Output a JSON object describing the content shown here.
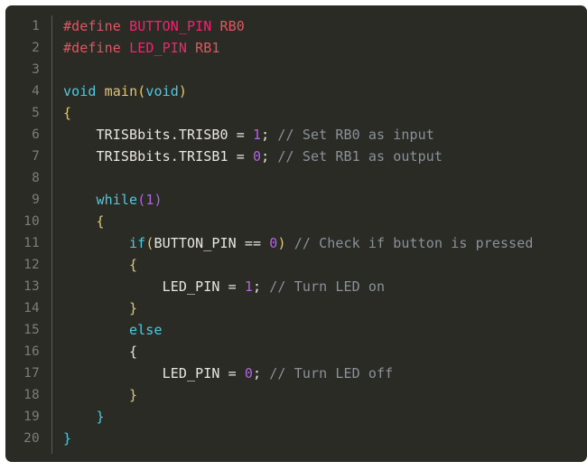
{
  "editor": {
    "title": "c-source-code-snippet",
    "language": "c",
    "background_color": "#2b2b26",
    "page_background_color": "#ffffff",
    "gutter_color": "#7d7d72",
    "gutter_rule_color": "#5a5a52",
    "default_text_color": "#e8e6df",
    "line_count": 20,
    "colors": {
      "preprocessor": "#e05561",
      "macro_name": "#f0256f",
      "macro_value": "#e05561",
      "keyword": "#4ec9e0",
      "function": "#e0c877",
      "number": "#b064dd",
      "comment": "#8a9199",
      "plain": "#e8e6df",
      "bracket_depth_1": "#e0c877",
      "bracket_depth_2": "#b064dd",
      "bracket_depth_3": "#4ec9e0"
    }
  },
  "lines": [
    {
      "number": "1",
      "text": "#define BUTTON_PIN RB0",
      "tokens": [
        {
          "t": "#define",
          "c": "tok-pre"
        },
        {
          "t": " ",
          "c": "tok-plain"
        },
        {
          "t": "BUTTON_PIN",
          "c": "tok-macro"
        },
        {
          "t": " ",
          "c": "tok-plain"
        },
        {
          "t": "RB0",
          "c": "tok-macroval"
        }
      ]
    },
    {
      "number": "2",
      "text": "#define LED_PIN RB1",
      "tokens": [
        {
          "t": "#define",
          "c": "tok-pre"
        },
        {
          "t": " ",
          "c": "tok-plain"
        },
        {
          "t": "LED_PIN",
          "c": "tok-macro"
        },
        {
          "t": " ",
          "c": "tok-plain"
        },
        {
          "t": "RB1",
          "c": "tok-macroval"
        }
      ]
    },
    {
      "number": "3",
      "text": "",
      "tokens": []
    },
    {
      "number": "4",
      "text": "void main(void)",
      "tokens": [
        {
          "t": "void",
          "c": "tok-kw"
        },
        {
          "t": " ",
          "c": "tok-plain"
        },
        {
          "t": "main",
          "c": "tok-fn"
        },
        {
          "t": "(",
          "c": "tok-b1"
        },
        {
          "t": "void",
          "c": "tok-kw"
        },
        {
          "t": ")",
          "c": "tok-b1"
        }
      ]
    },
    {
      "number": "5",
      "text": "{",
      "tokens": [
        {
          "t": "{",
          "c": "tok-b1"
        }
      ]
    },
    {
      "number": "6",
      "text": "    TRISBbits.TRISB0 = 1; // Set RB0 as input",
      "tokens": [
        {
          "t": "    TRISBbits.TRISB0 = ",
          "c": "tok-plain"
        },
        {
          "t": "1",
          "c": "tok-num"
        },
        {
          "t": "; ",
          "c": "tok-plain"
        },
        {
          "t": "// Set RB0 as input",
          "c": "tok-com"
        }
      ]
    },
    {
      "number": "7",
      "text": "    TRISBbits.TRISB1 = 0; // Set RB1 as output",
      "tokens": [
        {
          "t": "    TRISBbits.TRISB1 = ",
          "c": "tok-plain"
        },
        {
          "t": "0",
          "c": "tok-num"
        },
        {
          "t": "; ",
          "c": "tok-plain"
        },
        {
          "t": "// Set RB1 as output",
          "c": "tok-com"
        }
      ]
    },
    {
      "number": "8",
      "text": "",
      "tokens": []
    },
    {
      "number": "9",
      "text": "    while(1)",
      "tokens": [
        {
          "t": "    ",
          "c": "tok-plain"
        },
        {
          "t": "while",
          "c": "tok-kw"
        },
        {
          "t": "(",
          "c": "tok-b2"
        },
        {
          "t": "1",
          "c": "tok-num"
        },
        {
          "t": ")",
          "c": "tok-b2"
        }
      ]
    },
    {
      "number": "10",
      "text": "    {",
      "tokens": [
        {
          "t": "    ",
          "c": "tok-plain"
        },
        {
          "t": "{",
          "c": "tok-b1"
        }
      ]
    },
    {
      "number": "11",
      "text": "        if(BUTTON_PIN == 0) // Check if button is pressed",
      "tokens": [
        {
          "t": "        ",
          "c": "tok-plain"
        },
        {
          "t": "if",
          "c": "tok-kw"
        },
        {
          "t": "(",
          "c": "tok-b1"
        },
        {
          "t": "BUTTON_PIN == ",
          "c": "tok-plain"
        },
        {
          "t": "0",
          "c": "tok-num"
        },
        {
          "t": ")",
          "c": "tok-b1"
        },
        {
          "t": " ",
          "c": "tok-plain"
        },
        {
          "t": "// Check if button is pressed",
          "c": "tok-com"
        }
      ]
    },
    {
      "number": "12",
      "text": "        {",
      "tokens": [
        {
          "t": "        ",
          "c": "tok-plain"
        },
        {
          "t": "{",
          "c": "tok-b1"
        }
      ]
    },
    {
      "number": "13",
      "text": "            LED_PIN = 1; // Turn LED on",
      "tokens": [
        {
          "t": "            LED_PIN = ",
          "c": "tok-plain"
        },
        {
          "t": "1",
          "c": "tok-num"
        },
        {
          "t": "; ",
          "c": "tok-plain"
        },
        {
          "t": "// Turn LED on",
          "c": "tok-com"
        }
      ]
    },
    {
      "number": "14",
      "text": "        }",
      "tokens": [
        {
          "t": "        ",
          "c": "tok-plain"
        },
        {
          "t": "}",
          "c": "tok-b1"
        }
      ]
    },
    {
      "number": "15",
      "text": "        else",
      "tokens": [
        {
          "t": "        ",
          "c": "tok-plain"
        },
        {
          "t": "else",
          "c": "tok-kw"
        }
      ]
    },
    {
      "number": "16",
      "text": "        {",
      "tokens": [
        {
          "t": "        ",
          "c": "tok-plain"
        },
        {
          "t": "{",
          "c": "tok-plain"
        }
      ]
    },
    {
      "number": "17",
      "text": "            LED_PIN = 0; // Turn LED off",
      "tokens": [
        {
          "t": "            LED_PIN = ",
          "c": "tok-plain"
        },
        {
          "t": "0",
          "c": "tok-num"
        },
        {
          "t": "; ",
          "c": "tok-plain"
        },
        {
          "t": "// Turn LED off",
          "c": "tok-com"
        }
      ]
    },
    {
      "number": "18",
      "text": "        }",
      "tokens": [
        {
          "t": "        ",
          "c": "tok-plain"
        },
        {
          "t": "}",
          "c": "tok-b1"
        }
      ]
    },
    {
      "number": "19",
      "text": "    }",
      "tokens": [
        {
          "t": "    ",
          "c": "tok-plain"
        },
        {
          "t": "}",
          "c": "tok-b3"
        }
      ]
    },
    {
      "number": "20",
      "text": "}",
      "tokens": [
        {
          "t": "}",
          "c": "tok-b3"
        }
      ]
    }
  ]
}
